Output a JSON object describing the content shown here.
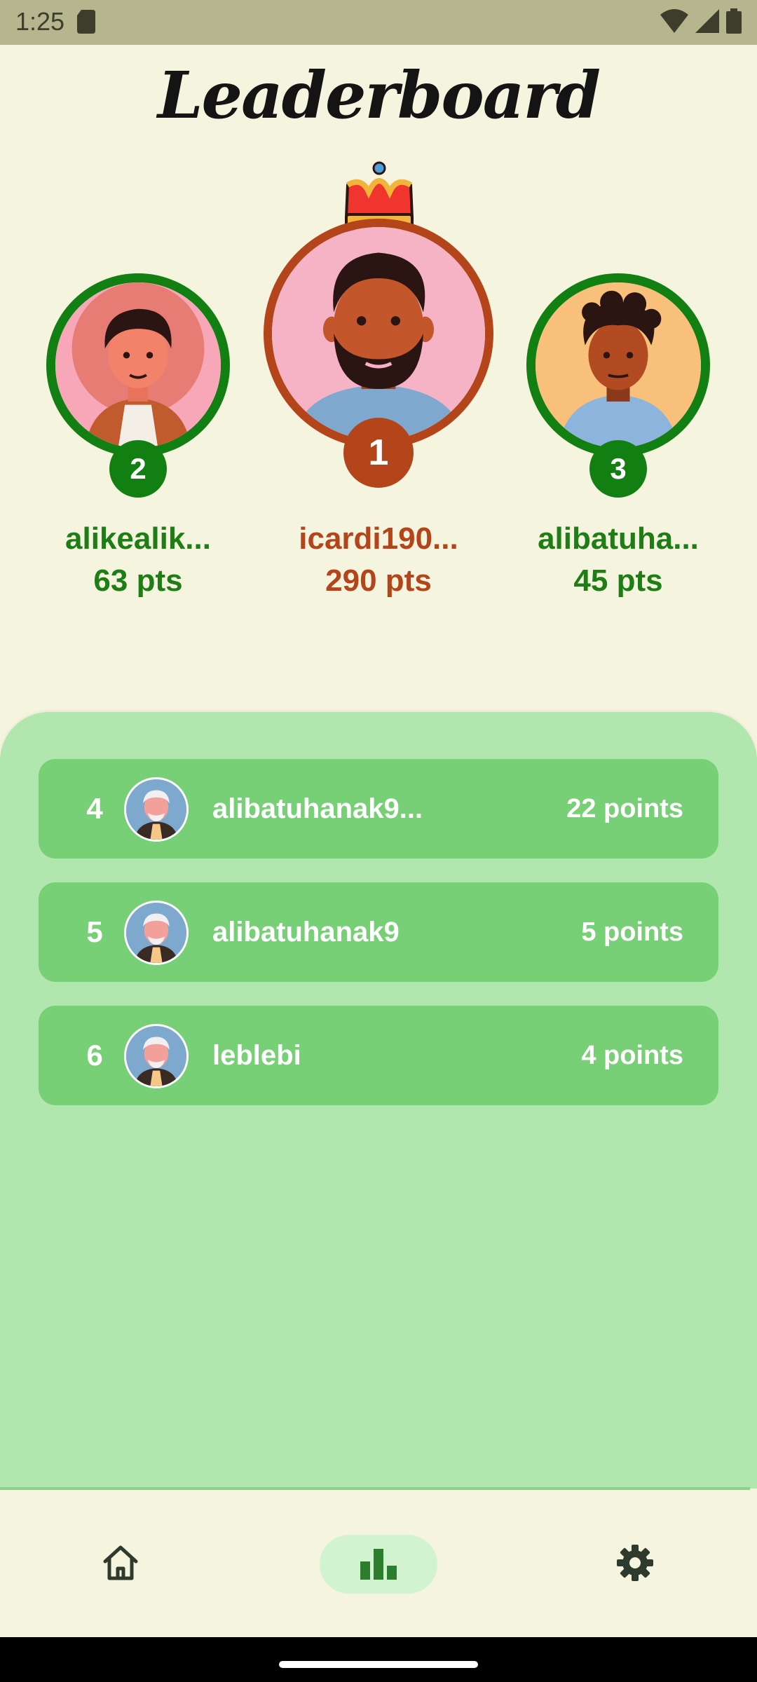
{
  "status_bar": {
    "time": "1:25",
    "icons": [
      "sd-card-icon",
      "wifi-icon",
      "cellular-icon",
      "battery-icon"
    ]
  },
  "header": {
    "title": "Leaderboard"
  },
  "podium": [
    {
      "rank": "2",
      "name": "alikealik...",
      "points": "63 pts",
      "color": "#1e7d14"
    },
    {
      "rank": "1",
      "name": "icardi190...",
      "points": "290 pts",
      "color": "#b4441a",
      "crown": "crown-icon"
    },
    {
      "rank": "3",
      "name": "alibatuha...",
      "points": "45 pts",
      "color": "#1e7d14"
    }
  ],
  "list": [
    {
      "rank": "4",
      "name": "alibatuhanak9...",
      "points": "22 points"
    },
    {
      "rank": "5",
      "name": "alibatuhanak9",
      "points": "5 points"
    },
    {
      "rank": "6",
      "name": "leblebi",
      "points": "4 points"
    }
  ],
  "bottom_nav": {
    "items": [
      {
        "icon": "home-icon",
        "active": false
      },
      {
        "icon": "leaderboard-icon",
        "active": true
      },
      {
        "icon": "settings-icon",
        "active": false
      }
    ]
  },
  "colors": {
    "background": "#f5f4de",
    "status_bar": "#b5b58e",
    "green_accent": "#1e7d14",
    "rust_accent": "#b4441a",
    "list_panel": "#b1e6ae",
    "list_row": "#77d075",
    "active_nav_pill": "#d2f3cf"
  }
}
